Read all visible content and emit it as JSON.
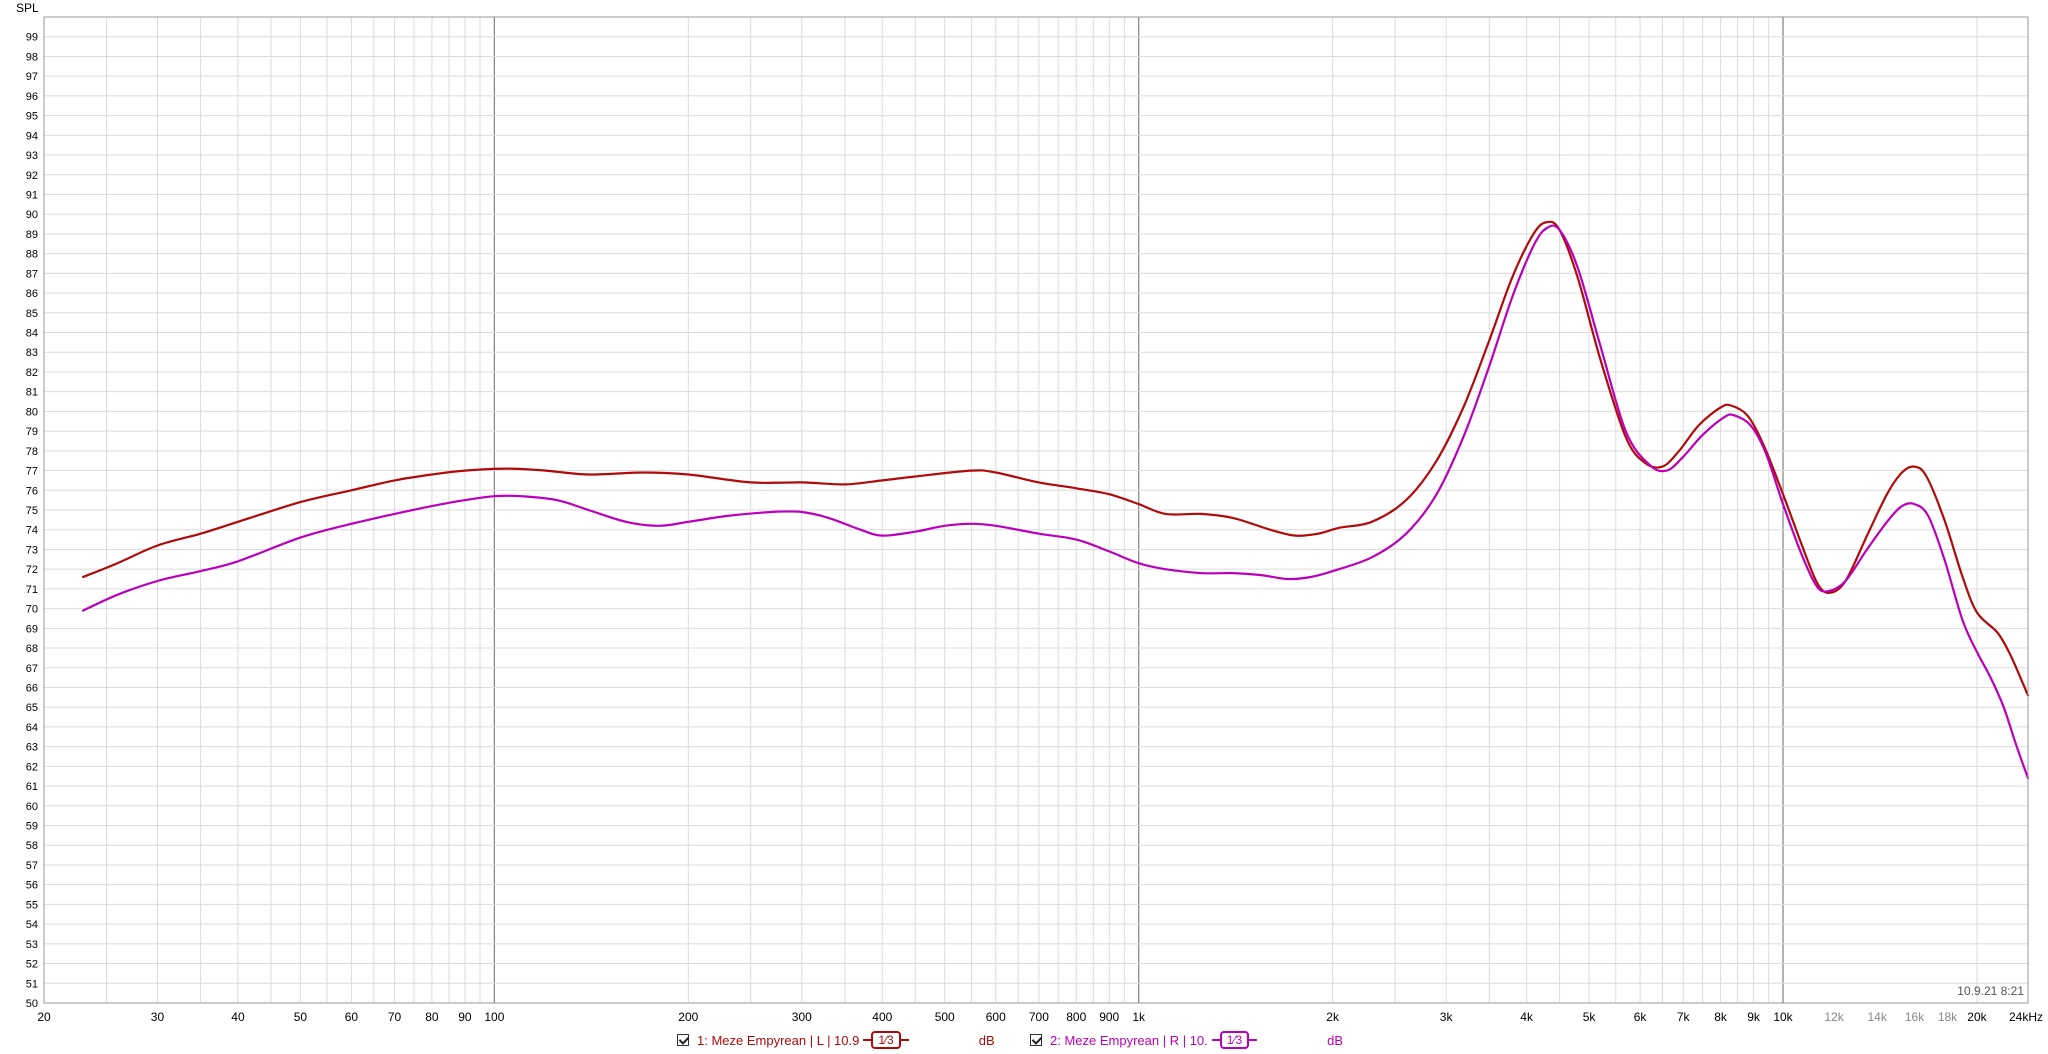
{
  "y_axis_title": "SPL",
  "timestamp": "10.9.21 8:21",
  "colors": {
    "left": "#b00a0a",
    "right": "#bb00bb",
    "grid_minor": "#dcdcdc",
    "grid_major": "#808080",
    "frame": "#9a9a9a"
  },
  "x_tick_labels": [
    "20",
    "30",
    "40",
    "50",
    "60",
    "70",
    "80",
    "90",
    "100",
    "200",
    "300",
    "400",
    "500",
    "600",
    "700",
    "800",
    "900",
    "1k",
    "2k",
    "3k",
    "4k",
    "5k",
    "6k",
    "7k",
    "8k",
    "9k",
    "10k",
    "12k",
    "14k",
    "16k",
    "18k",
    "20k",
    "24kHz"
  ],
  "x_tick_values": [
    20,
    30,
    40,
    50,
    60,
    70,
    80,
    90,
    100,
    200,
    300,
    400,
    500,
    600,
    700,
    800,
    900,
    1000,
    2000,
    3000,
    4000,
    5000,
    6000,
    7000,
    8000,
    9000,
    10000,
    12000,
    14000,
    16000,
    18000,
    20000,
    24000
  ],
  "legend": [
    {
      "index_label": "1: Meze Empyrean | L | 10.9",
      "smoothing": "1⁄3",
      "unit": "dB"
    },
    {
      "index_label": "2: Meze Empyrean | R | 10.",
      "smoothing": "1⁄3",
      "unit": "dB"
    }
  ],
  "chart_data": {
    "type": "line",
    "title": "",
    "xlabel": "",
    "ylabel": "SPL",
    "x_scale": "log",
    "xlim": [
      20,
      24000
    ],
    "ylim": [
      50,
      100
    ],
    "y_tick_step": 1,
    "grid": true,
    "legend_position": "bottom",
    "series": [
      {
        "name": "1: Meze Empyrean | L | 10.9",
        "color": "#b00a0a",
        "points": [
          [
            23,
            71.6
          ],
          [
            26,
            72.3
          ],
          [
            30,
            73.2
          ],
          [
            35,
            73.8
          ],
          [
            40,
            74.4
          ],
          [
            50,
            75.4
          ],
          [
            60,
            76.0
          ],
          [
            70,
            76.5
          ],
          [
            80,
            76.8
          ],
          [
            90,
            77.0
          ],
          [
            105,
            77.1
          ],
          [
            120,
            77.0
          ],
          [
            140,
            76.8
          ],
          [
            170,
            76.9
          ],
          [
            200,
            76.8
          ],
          [
            250,
            76.4
          ],
          [
            300,
            76.4
          ],
          [
            350,
            76.3
          ],
          [
            400,
            76.5
          ],
          [
            450,
            76.7
          ],
          [
            550,
            77.0
          ],
          [
            600,
            76.9
          ],
          [
            700,
            76.4
          ],
          [
            800,
            76.1
          ],
          [
            900,
            75.8
          ],
          [
            1000,
            75.3
          ],
          [
            1100,
            74.8
          ],
          [
            1250,
            74.8
          ],
          [
            1400,
            74.6
          ],
          [
            1600,
            74.0
          ],
          [
            1750,
            73.7
          ],
          [
            1900,
            73.8
          ],
          [
            2050,
            74.1
          ],
          [
            2300,
            74.4
          ],
          [
            2600,
            75.5
          ],
          [
            2900,
            77.5
          ],
          [
            3200,
            80.3
          ],
          [
            3500,
            83.6
          ],
          [
            3800,
            86.8
          ],
          [
            4100,
            89.0
          ],
          [
            4300,
            89.6
          ],
          [
            4500,
            89.2
          ],
          [
            4800,
            86.8
          ],
          [
            5200,
            82.7
          ],
          [
            5700,
            78.7
          ],
          [
            6100,
            77.4
          ],
          [
            6500,
            77.2
          ],
          [
            6900,
            78.0
          ],
          [
            7400,
            79.3
          ],
          [
            8000,
            80.2
          ],
          [
            8300,
            80.3
          ],
          [
            8800,
            79.8
          ],
          [
            9300,
            78.4
          ],
          [
            10000,
            75.8
          ],
          [
            10700,
            73.2
          ],
          [
            11300,
            71.3
          ],
          [
            11800,
            70.8
          ],
          [
            12500,
            71.4
          ],
          [
            13500,
            73.7
          ],
          [
            14500,
            75.8
          ],
          [
            15300,
            76.9
          ],
          [
            16000,
            77.2
          ],
          [
            16700,
            76.7
          ],
          [
            17800,
            74.5
          ],
          [
            19000,
            71.6
          ],
          [
            20000,
            69.8
          ],
          [
            21500,
            68.8
          ],
          [
            22500,
            67.7
          ],
          [
            23500,
            66.3
          ],
          [
            24000,
            65.6
          ]
        ]
      },
      {
        "name": "2: Meze Empyrean | R | 10.",
        "color": "#bb00bb",
        "points": [
          [
            23,
            69.9
          ],
          [
            26,
            70.7
          ],
          [
            30,
            71.4
          ],
          [
            35,
            71.9
          ],
          [
            40,
            72.4
          ],
          [
            50,
            73.6
          ],
          [
            60,
            74.3
          ],
          [
            70,
            74.8
          ],
          [
            80,
            75.2
          ],
          [
            90,
            75.5
          ],
          [
            100,
            75.7
          ],
          [
            110,
            75.7
          ],
          [
            125,
            75.5
          ],
          [
            140,
            75.0
          ],
          [
            160,
            74.4
          ],
          [
            180,
            74.2
          ],
          [
            200,
            74.4
          ],
          [
            230,
            74.7
          ],
          [
            270,
            74.9
          ],
          [
            300,
            74.9
          ],
          [
            330,
            74.6
          ],
          [
            370,
            74.0
          ],
          [
            400,
            73.7
          ],
          [
            450,
            73.9
          ],
          [
            500,
            74.2
          ],
          [
            550,
            74.3
          ],
          [
            600,
            74.2
          ],
          [
            700,
            73.8
          ],
          [
            800,
            73.5
          ],
          [
            900,
            72.9
          ],
          [
            1000,
            72.3
          ],
          [
            1100,
            72.0
          ],
          [
            1250,
            71.8
          ],
          [
            1400,
            71.8
          ],
          [
            1550,
            71.7
          ],
          [
            1700,
            71.5
          ],
          [
            1850,
            71.6
          ],
          [
            2000,
            71.9
          ],
          [
            2300,
            72.6
          ],
          [
            2600,
            73.8
          ],
          [
            2900,
            75.8
          ],
          [
            3200,
            78.8
          ],
          [
            3500,
            82.3
          ],
          [
            3800,
            85.8
          ],
          [
            4100,
            88.4
          ],
          [
            4300,
            89.3
          ],
          [
            4500,
            89.2
          ],
          [
            4800,
            87.3
          ],
          [
            5200,
            83.4
          ],
          [
            5700,
            79.0
          ],
          [
            6200,
            77.3
          ],
          [
            6600,
            77.0
          ],
          [
            7000,
            77.7
          ],
          [
            7500,
            78.8
          ],
          [
            8100,
            79.7
          ],
          [
            8400,
            79.8
          ],
          [
            8900,
            79.3
          ],
          [
            9400,
            77.9
          ],
          [
            10000,
            75.3
          ],
          [
            10700,
            72.7
          ],
          [
            11300,
            71.1
          ],
          [
            11800,
            70.9
          ],
          [
            12500,
            71.4
          ],
          [
            13500,
            73.0
          ],
          [
            14500,
            74.4
          ],
          [
            15300,
            75.2
          ],
          [
            16000,
            75.3
          ],
          [
            16800,
            74.7
          ],
          [
            17800,
            72.5
          ],
          [
            19000,
            69.4
          ],
          [
            20000,
            67.8
          ],
          [
            21000,
            66.5
          ],
          [
            22000,
            65.0
          ],
          [
            23000,
            63.1
          ],
          [
            24000,
            61.4
          ]
        ]
      }
    ]
  }
}
